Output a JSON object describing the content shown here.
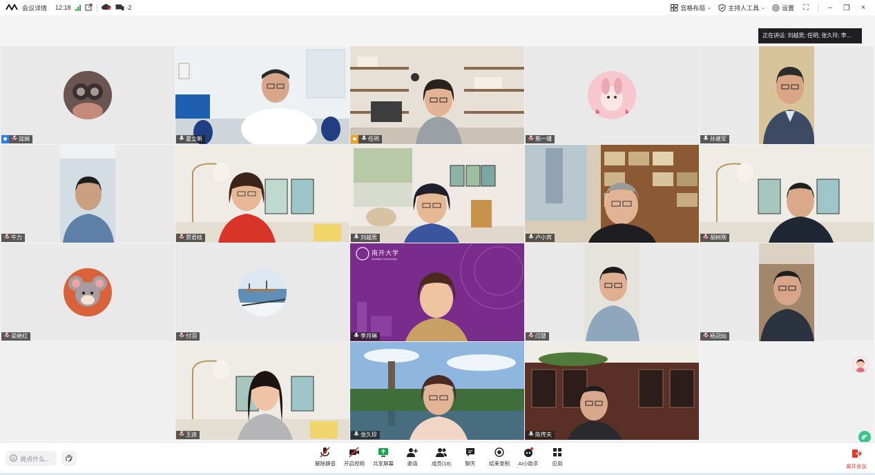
{
  "topbar": {
    "meeting_info": "会议详情",
    "time": "12:18",
    "device_label": "·2",
    "layout_label": "宫格布局",
    "host_tools_label": "主持人工具",
    "settings_label": "设置"
  },
  "speaking": {
    "prefix": "正在讲话:",
    "names": "刘越男; 任明; 张久玲; 李..."
  },
  "participants": {
    "p1": "寇娴",
    "p2": "夏立新",
    "p3": "任明",
    "p4": "熊一璠",
    "p5": "孙建军",
    "p6": "牛力",
    "p7": "贾君枝",
    "p8": "刘越男",
    "p9": "卢小宾",
    "p10": "胡树刚",
    "p11": "梁继红",
    "p12": "付羽",
    "p13": "李月琳",
    "p14": "闫慧",
    "p15": "杨冠灿",
    "p16": "王迪",
    "p17": "张久珍",
    "p18": "陈传夫"
  },
  "slide": {
    "university": "南开大学",
    "university_en": "Nankai University"
  },
  "bottombar": {
    "chat_placeholder": "说点什么...",
    "tools": {
      "unmute": "解除静音",
      "video": "开启视频",
      "share": "共享屏幕",
      "invite": "邀请",
      "members": "成员(18)",
      "chat": "聊天",
      "record": "结束录制",
      "ai": "AI小助手",
      "apps": "应用"
    },
    "leave": "离开会议"
  },
  "colors": {
    "accent_blue": "#2b7cf6",
    "active_green": "#3bd08c",
    "leave_red": "#e5382d",
    "purple_bg": "#7a2c8c"
  }
}
